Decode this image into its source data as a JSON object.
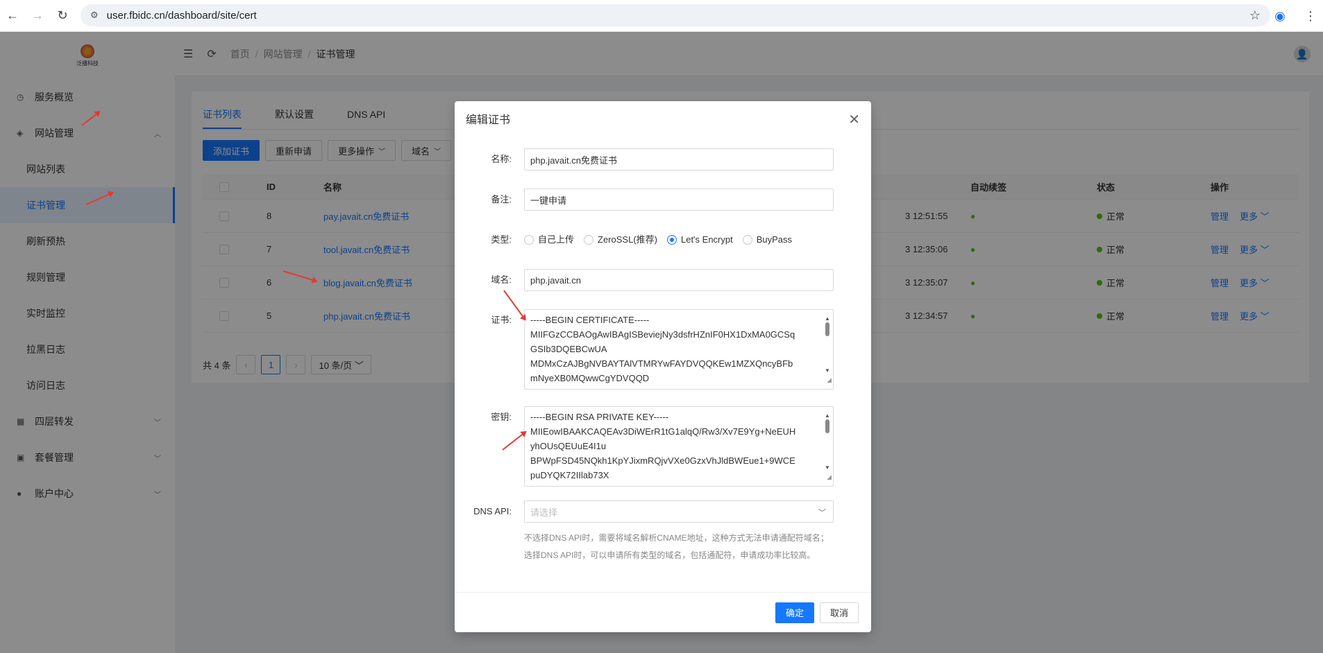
{
  "browser": {
    "url": "user.fbidc.cn/dashboard/site/cert"
  },
  "sidebar": {
    "logo_text": "泛播科技",
    "items": [
      {
        "label": "服务概览",
        "icon": "dashboard-icon"
      },
      {
        "label": "网站管理",
        "icon": "website-icon",
        "expanded": true
      },
      {
        "label": "四层转发",
        "icon": "forward-icon"
      },
      {
        "label": "套餐管理",
        "icon": "package-icon"
      },
      {
        "label": "账户中心",
        "icon": "user-icon"
      }
    ],
    "subitems": [
      {
        "label": "网站列表"
      },
      {
        "label": "证书管理",
        "active": true
      },
      {
        "label": "刷新预热"
      },
      {
        "label": "规则管理"
      },
      {
        "label": "实时监控"
      },
      {
        "label": "拉黑日志"
      },
      {
        "label": "访问日志"
      }
    ]
  },
  "topbar": {
    "breadcrumb": [
      "首页",
      "网站管理",
      "证书管理"
    ]
  },
  "page": {
    "tabs": [
      "证书列表",
      "默认设置",
      "DNS API"
    ],
    "toolbar": {
      "add": "添加证书",
      "reapply": "重新申请",
      "more_ops": "更多操作",
      "domain": "域名"
    },
    "table": {
      "headers": {
        "id": "ID",
        "name": "名称",
        "auto_renew": "自动续签",
        "status": "状态",
        "ops": "操作"
      },
      "rows": [
        {
          "id": "8",
          "name": "pay.javait.cn免费证书",
          "time": "3 12:51:55",
          "status": "正常",
          "manage": "管理",
          "more": "更多"
        },
        {
          "id": "7",
          "name": "tool.javait.cn免费证书",
          "time": "3 12:35:06",
          "status": "正常",
          "manage": "管理",
          "more": "更多"
        },
        {
          "id": "6",
          "name": "blog.javait.cn免费证书",
          "time": "3 12:35:07",
          "status": "正常",
          "manage": "管理",
          "more": "更多"
        },
        {
          "id": "5",
          "name": "php.javait.cn免费证书",
          "time": "3 12:34:57",
          "status": "正常",
          "manage": "管理",
          "more": "更多"
        }
      ]
    },
    "pager": {
      "total": "共 4 条",
      "page": "1",
      "size": "10 条/页"
    }
  },
  "modal": {
    "title": "编辑证书",
    "fields": {
      "name_label": "名称:",
      "name_value": "php.javait.cn免费证书",
      "remark_label": "备注:",
      "remark_value": "一键申请",
      "type_label": "类型:",
      "types": [
        "自己上传",
        "ZeroSSL(推荐)",
        "Let's Encrypt",
        "BuyPass"
      ],
      "selected_type": "Let's Encrypt",
      "domain_label": "域名:",
      "domain_value": "php.javait.cn",
      "cert_label": "证书:",
      "cert_lines": [
        "-----BEGIN CERTIFICATE-----",
        "MIIFGzCCBAOgAwIBAgISBeviejNy3dsfrHZnIF0HX1DxMA0GCSq",
        "GSIb3DQEBCwUA",
        "MDMxCzAJBgNVBAYTAlVTMRYwFAYDVQQKEw1MZXQncyBFb",
        "mNyeXB0MQwwCgYDVQQD"
      ],
      "key_label": "密钥:",
      "key_lines": [
        "-----BEGIN RSA PRIVATE KEY-----",
        "MIIEowIBAAKCAQEAv3DiWErR1tG1alqQ/Rw3/Xv7E9Yg+NeEUH",
        "yhOUsQEUuE4I1u",
        "BPWpFSD45NQkh1KpYJixmRQjvVXe0GzxVhJldBWEue1+9WCE",
        "puDYQK72IIlab73X"
      ],
      "dnsapi_label": "DNS API:",
      "dnsapi_placeholder": "请选择",
      "hint_line1": "不选择DNS API时，需要将域名解析CNAME地址，这种方式无法申请通配符域名；",
      "hint_line2": "选择DNS API时，可以申请所有类型的域名，包括通配符，申请成功率比较高。"
    },
    "ok": "确定",
    "cancel": "取消"
  },
  "colors": {
    "accent": "#1677ff",
    "success": "#52c41a",
    "annotation": "#e53935"
  }
}
